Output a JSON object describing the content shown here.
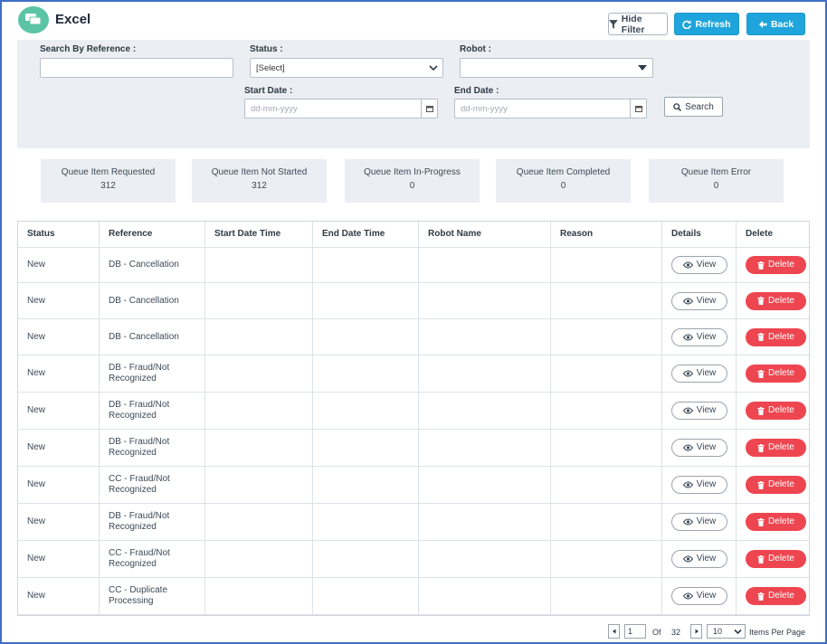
{
  "header": {
    "title": "Excel",
    "hide_filter_label": "Hide Filter",
    "refresh_label": "Refresh",
    "back_label": "Back"
  },
  "filters": {
    "search_reference_label": "Search By Reference :",
    "search_reference_value": "",
    "status_label": "Status :",
    "status_value": "[Select]",
    "robot_label": "Robot :",
    "robot_value": "",
    "start_date_label": "Start Date :",
    "start_date_placeholder": "dd-mm-yyyy",
    "end_date_label": "End Date :",
    "end_date_placeholder": "dd-mm-yyyy",
    "search_button_label": "Search"
  },
  "stats": [
    {
      "label": "Queue Item Requested",
      "value": "312"
    },
    {
      "label": "Queue Item Not Started",
      "value": "312"
    },
    {
      "label": "Queue Item In-Progress",
      "value": "0"
    },
    {
      "label": "Queue Item Completed",
      "value": "0"
    },
    {
      "label": "Queue Item Error",
      "value": "0"
    }
  ],
  "table": {
    "columns": [
      "Status",
      "Reference",
      "Start Date Time",
      "End Date Time",
      "Robot Name",
      "Reason",
      "Details",
      "Delete"
    ],
    "view_label": "View",
    "delete_label": "Delete",
    "rows": [
      {
        "status": "New",
        "reference": "DB - Cancellation",
        "start": "",
        "end": "",
        "robot": "",
        "reason": ""
      },
      {
        "status": "New",
        "reference": "DB - Cancellation",
        "start": "",
        "end": "",
        "robot": "",
        "reason": ""
      },
      {
        "status": "New",
        "reference": "DB - Cancellation",
        "start": "",
        "end": "",
        "robot": "",
        "reason": ""
      },
      {
        "status": "New",
        "reference": "DB - Fraud/Not Recognized",
        "start": "",
        "end": "",
        "robot": "",
        "reason": ""
      },
      {
        "status": "New",
        "reference": "DB - Fraud/Not Recognized",
        "start": "",
        "end": "",
        "robot": "",
        "reason": ""
      },
      {
        "status": "New",
        "reference": "DB - Fraud/Not Recognized",
        "start": "",
        "end": "",
        "robot": "",
        "reason": ""
      },
      {
        "status": "New",
        "reference": "CC - Fraud/Not Recognized",
        "start": "",
        "end": "",
        "robot": "",
        "reason": ""
      },
      {
        "status": "New",
        "reference": "DB - Fraud/Not Recognized",
        "start": "",
        "end": "",
        "robot": "",
        "reason": ""
      },
      {
        "status": "New",
        "reference": "CC - Fraud/Not Recognized",
        "start": "",
        "end": "",
        "robot": "",
        "reason": ""
      },
      {
        "status": "New",
        "reference": "CC - Duplicate Processing",
        "start": "",
        "end": "",
        "robot": "",
        "reason": ""
      }
    ]
  },
  "pagination": {
    "current_page": "1",
    "of_label": "Of",
    "total_pages": "32",
    "per_page_value": "10",
    "per_page_label": "Items Per Page"
  },
  "colors": {
    "accent": "#1fa5dc",
    "danger": "#ee4650",
    "app_icon": "#5bc4a4",
    "panel": "#ebeef2"
  },
  "icons": [
    "app-chat-icon",
    "filter-icon",
    "refresh-icon",
    "arrow-left-icon",
    "chevron-down-icon",
    "calendar-icon",
    "search-icon",
    "eye-icon",
    "trash-icon",
    "prev-page-icon",
    "next-page-icon"
  ]
}
